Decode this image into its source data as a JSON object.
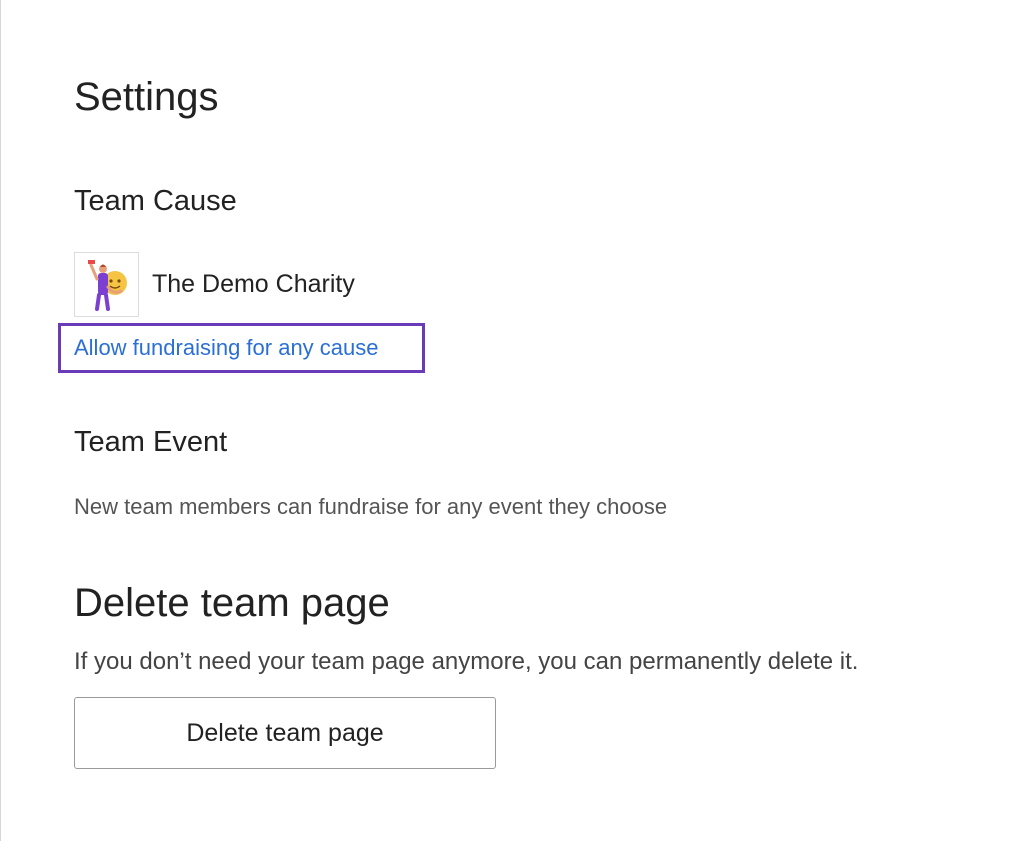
{
  "settings": {
    "title": "Settings"
  },
  "team_cause": {
    "heading": "Team Cause",
    "charity_name": "The Demo Charity",
    "charity_logo_icon": "charity-illustration-icon",
    "allow_link_label": "Allow fundraising for any cause"
  },
  "team_event": {
    "heading": "Team Event",
    "description": "New team members can fundraise for any event they choose"
  },
  "delete_section": {
    "heading": "Delete team page",
    "description": "If you don’t need your team page anymore, you can permanently delete it.",
    "button_label": "Delete team page"
  },
  "colors": {
    "link": "#2a6fd6",
    "focus_outline": "#6a3ab8",
    "text_primary": "#222222",
    "text_secondary": "#555555"
  }
}
